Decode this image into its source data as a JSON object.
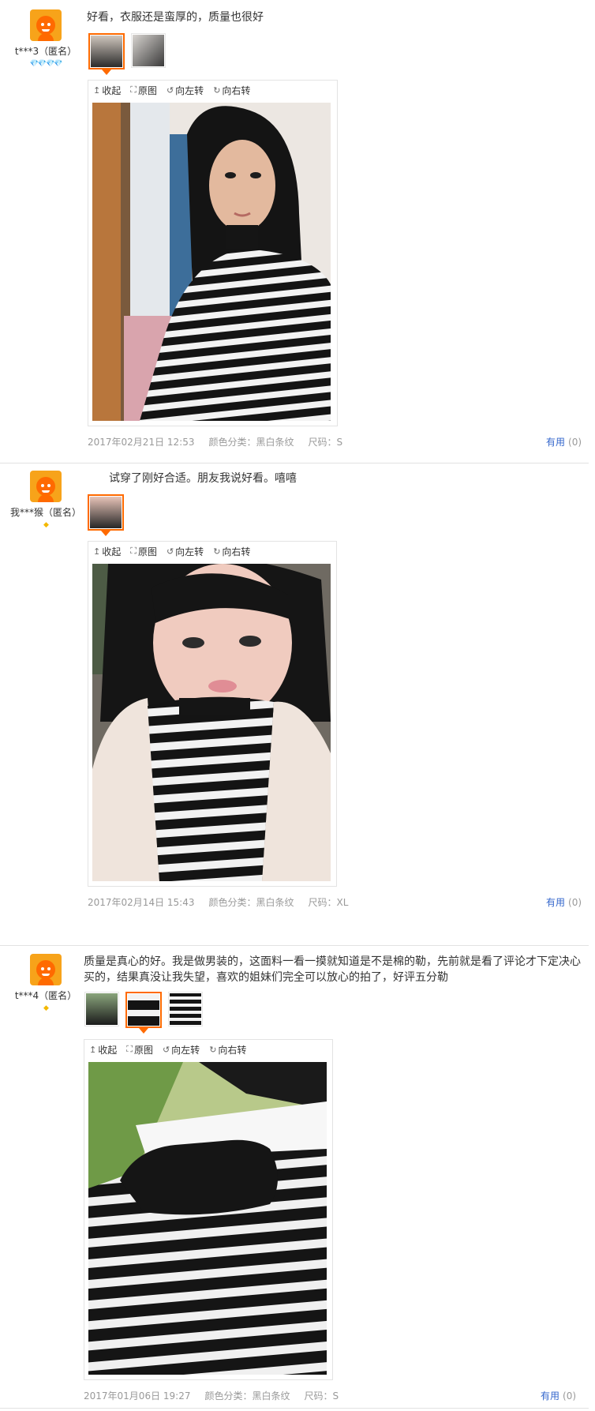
{
  "colors": {
    "accent": "#ff6a00",
    "link": "#3366cc",
    "meta": "#999999",
    "rank_red": "#e8392b",
    "rank_gold": "#f3b800"
  },
  "toolbar": {
    "collapse": "收起",
    "original": "原图",
    "rotate_left": "向左转",
    "rotate_right": "向右转"
  },
  "reviews": [
    {
      "user": "t***3（匿名）",
      "rank_icons": "💎💎💎💎",
      "text": "好看，衣服还是蛮厚的，质量也很好",
      "date": "2017年02月21日 12:53",
      "color": "颜色分类：黑白条纹",
      "size": "尺码：S",
      "useful_label": "有用",
      "useful_count": "(0)",
      "thumbnails": [
        "photo-girl-stripes",
        "photo-girl-stripes-2"
      ]
    },
    {
      "user": "我***猴（匿名）",
      "rank_icons": "◆",
      "text": "试穿了刚好合适。朋友我说好看。嘻嘻",
      "date": "2017年02月14日 15:43",
      "color": "颜色分类：黑白条纹",
      "size": "尺码：XL",
      "useful_label": "有用",
      "useful_count": "(0)",
      "thumbnails": [
        "photo-selfie-fleece"
      ]
    },
    {
      "user": "t***4（匿名）",
      "rank_icons": "◆",
      "text": "质量是真心的好。我是做男装的，这面料一看一摸就知道是不是棉的勒，先前就是看了评论才下定决心买的，结果真没让我失望，喜欢的姐妹们完全可以放心的拍了，好评五分勒",
      "date": "2017年01月06日 19:27",
      "color": "颜色分类：黑白条纹",
      "size": "尺码：S",
      "useful_label": "有用",
      "useful_count": "(0)",
      "thumbnails": [
        "photo-flat-1",
        "photo-flat-2",
        "photo-flat-3"
      ]
    }
  ]
}
